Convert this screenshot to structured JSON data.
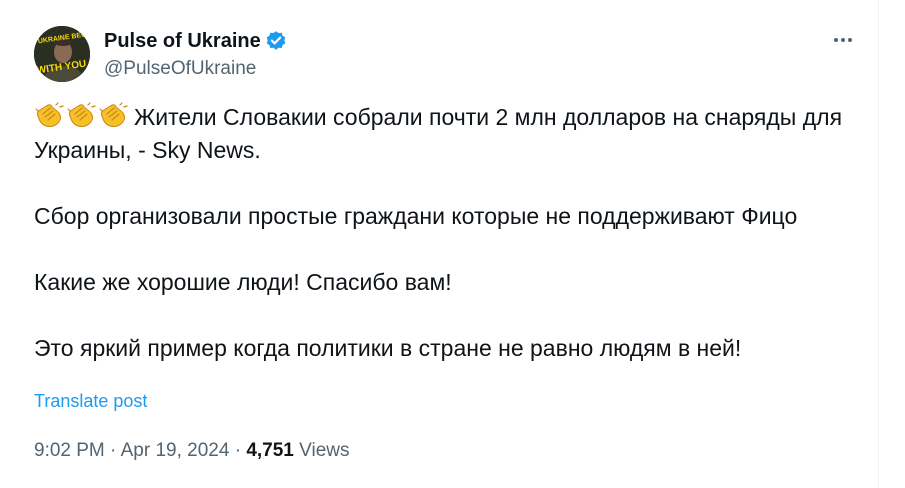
{
  "author": {
    "name": "Pulse of Ukraine",
    "handle": "@PulseOfUkraine",
    "avatar_text_top": "UKRAINE BEGINS",
    "avatar_text_bottom": "WITH YOU"
  },
  "post": {
    "emoji_icons": [
      "clapping-hands-icon",
      "clapping-hands-icon",
      "clapping-hands-icon"
    ],
    "line1": "Жители Словакии собрали почти 2 млн долларов на снаряды для Украины, - Sky News.",
    "paragraph2": "Сбор организовали простые граждани которые не поддерживают Фицо",
    "paragraph3": "Какие же хорошие люди! Спасибо вам!",
    "paragraph4": "Это яркий пример когда политики в стране не равно людям в ней!"
  },
  "translate_label": "Translate post",
  "meta": {
    "time": "9:02 PM",
    "separator": "·",
    "date": "Apr 19, 2024",
    "views_count": "4,751",
    "views_label": "Views"
  },
  "colors": {
    "text": "#0f1419",
    "secondary": "#536471",
    "link": "#1d9bf0",
    "verified": "#1d9bf0",
    "avatar_text": "#f5d90a"
  }
}
